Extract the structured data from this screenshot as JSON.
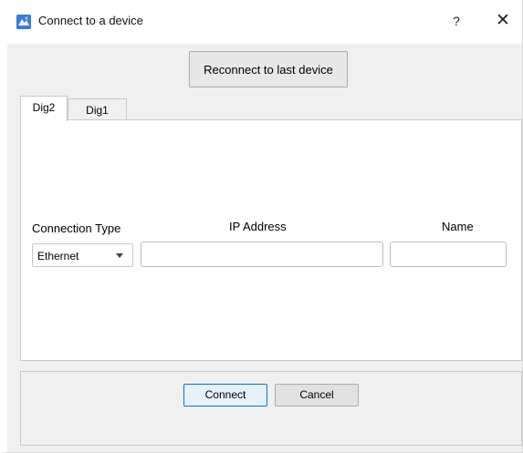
{
  "window": {
    "title": "Connect to a device",
    "help_label": "?",
    "close_label": "✕"
  },
  "reconnect_label": "Reconnect to last device",
  "tabs": [
    {
      "label": "Dig2",
      "active": true
    },
    {
      "label": "Dig1",
      "active": false
    }
  ],
  "form": {
    "connection_type_label": "Connection Type",
    "connection_type_value": "Ethernet",
    "ip_label": "IP Address",
    "ip_value": "",
    "name_label": "Name",
    "name_value": ""
  },
  "buttons": {
    "connect_label": "Connect",
    "cancel_label": "Cancel"
  },
  "colors": {
    "accent": "#0078d7",
    "window_bg": "#f0f0f0",
    "panel_bg": "#ffffff"
  },
  "icons": {
    "app": "app-icon",
    "dropdown": "chevron-down-icon"
  }
}
